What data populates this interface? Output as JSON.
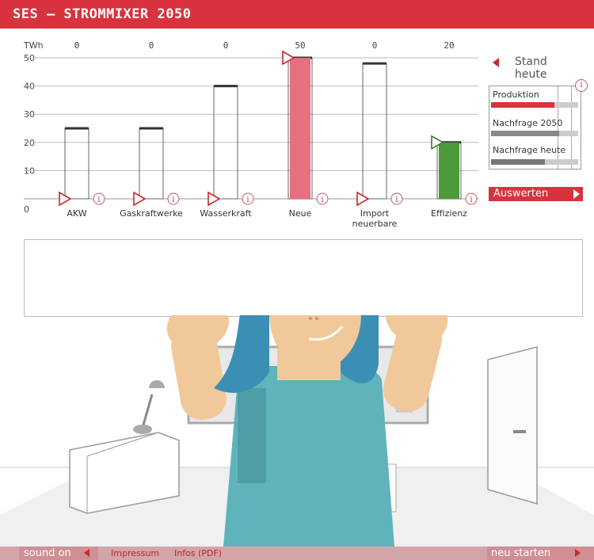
{
  "app": {
    "title": "SES – STROMMIXER 2050"
  },
  "side": {
    "stand_heute": "Stand heute",
    "panel_rows": [
      "Produktion",
      "Nachfrage 2050",
      "Nachfrage heute"
    ],
    "info": "i",
    "auswerten": "Auswerten"
  },
  "footer": {
    "sound": "sound on",
    "impressum": "Impressum",
    "infos": "Infos (PDF)",
    "neu": "neu starten"
  },
  "colors": {
    "accent": "#d8323c",
    "neue": "#e7707e",
    "effizienz": "#4c9a3a",
    "hair": "#3b8fb5",
    "shirt": "#5fb3ba"
  },
  "chart_data": {
    "type": "bar",
    "unit_label": "TWh",
    "yticks": [
      "50",
      "40",
      "30",
      "20",
      "10",
      "0"
    ],
    "ylim": [
      0,
      50
    ],
    "categories": [
      "AKW",
      "Gaskraftwerke",
      "Wasserkraft",
      "Neue",
      "Import\nneuerbare",
      "Effizienz"
    ],
    "category_labels": [
      [
        "AKW"
      ],
      [
        "Gaskraftwerke"
      ],
      [
        "Wasserkraft"
      ],
      [
        "Neue"
      ],
      [
        "Import",
        "neuerbare"
      ],
      [
        "Effizienz"
      ]
    ],
    "top_values": [
      "0",
      "0",
      "0",
      "50",
      "0",
      "20"
    ],
    "selected_values": [
      0,
      0,
      0,
      50,
      0,
      20
    ],
    "target_values": [
      25,
      25,
      40,
      50,
      48,
      20
    ],
    "series_colors": [
      "none",
      "none",
      "none",
      "#e7707e",
      "none",
      "#4c9a3a"
    ]
  }
}
